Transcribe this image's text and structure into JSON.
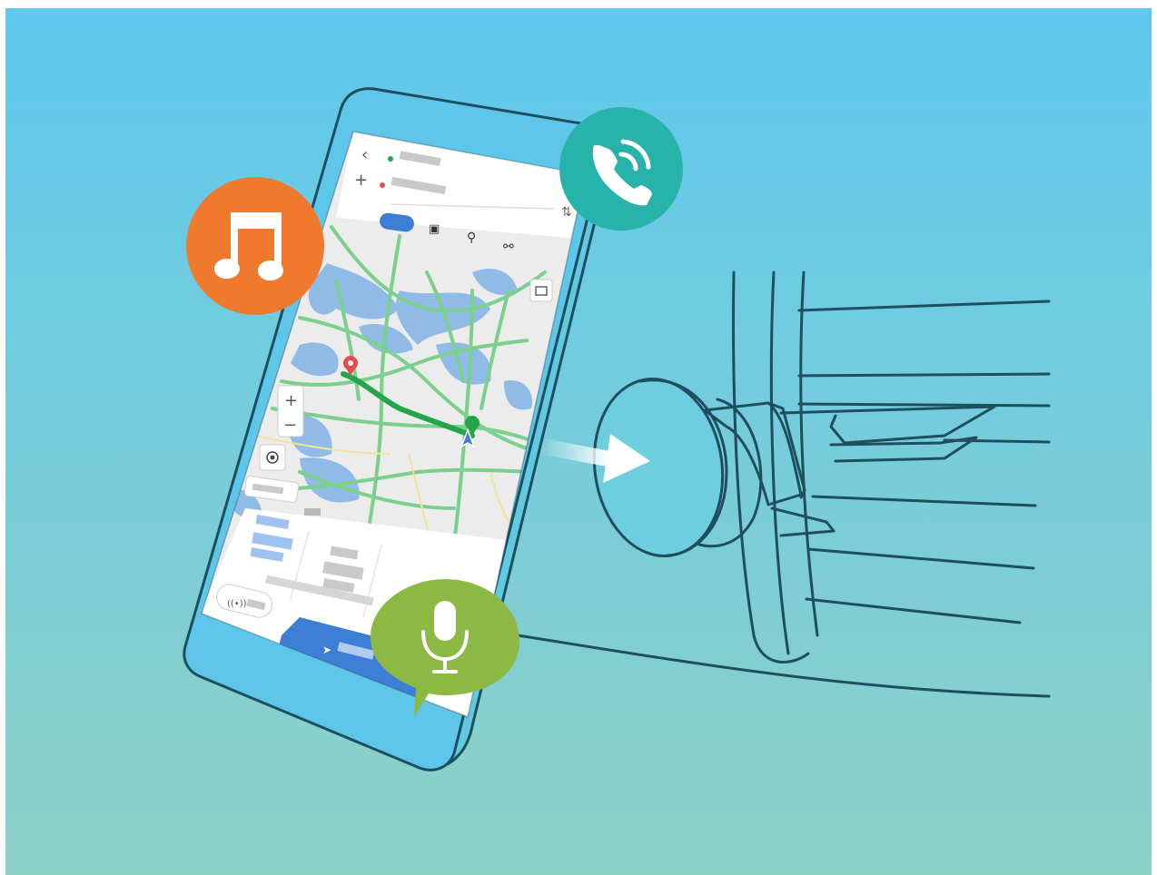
{
  "colors": {
    "background_top": "#5ec8ee",
    "background_bottom": "#8ed1c7",
    "outline": "#1e4f5e",
    "music_bubble": "#ef7a2e",
    "phone_bubble": "#27b3a9",
    "mic_bubble": "#8cb943",
    "route_line": "#23a54b",
    "map_water": "#8fbbe6",
    "map_land": "#ececec",
    "map_road": "#7cd08e",
    "tab_active": "#3d7ed7",
    "navigate_button": "#3d7ed7"
  },
  "icons": {
    "music": "music-note-icon",
    "phone": "phone-call-icon",
    "microphone": "microphone-icon",
    "arrow": "arrow-right-icon",
    "back": "back-arrow-icon",
    "add": "plus-icon",
    "swap": "swap-icon",
    "bus": "bus-icon",
    "walk": "walk-icon",
    "bike": "bike-icon",
    "zoom_in": "zoom-in-icon",
    "zoom_out": "zoom-out-icon",
    "locate": "locate-icon",
    "briefcase": "briefcase-icon",
    "origin": "origin-pin-icon",
    "destination": "destination-pin-icon"
  },
  "map": {
    "zoom_in_label": "+",
    "zoom_out_label": "−"
  }
}
